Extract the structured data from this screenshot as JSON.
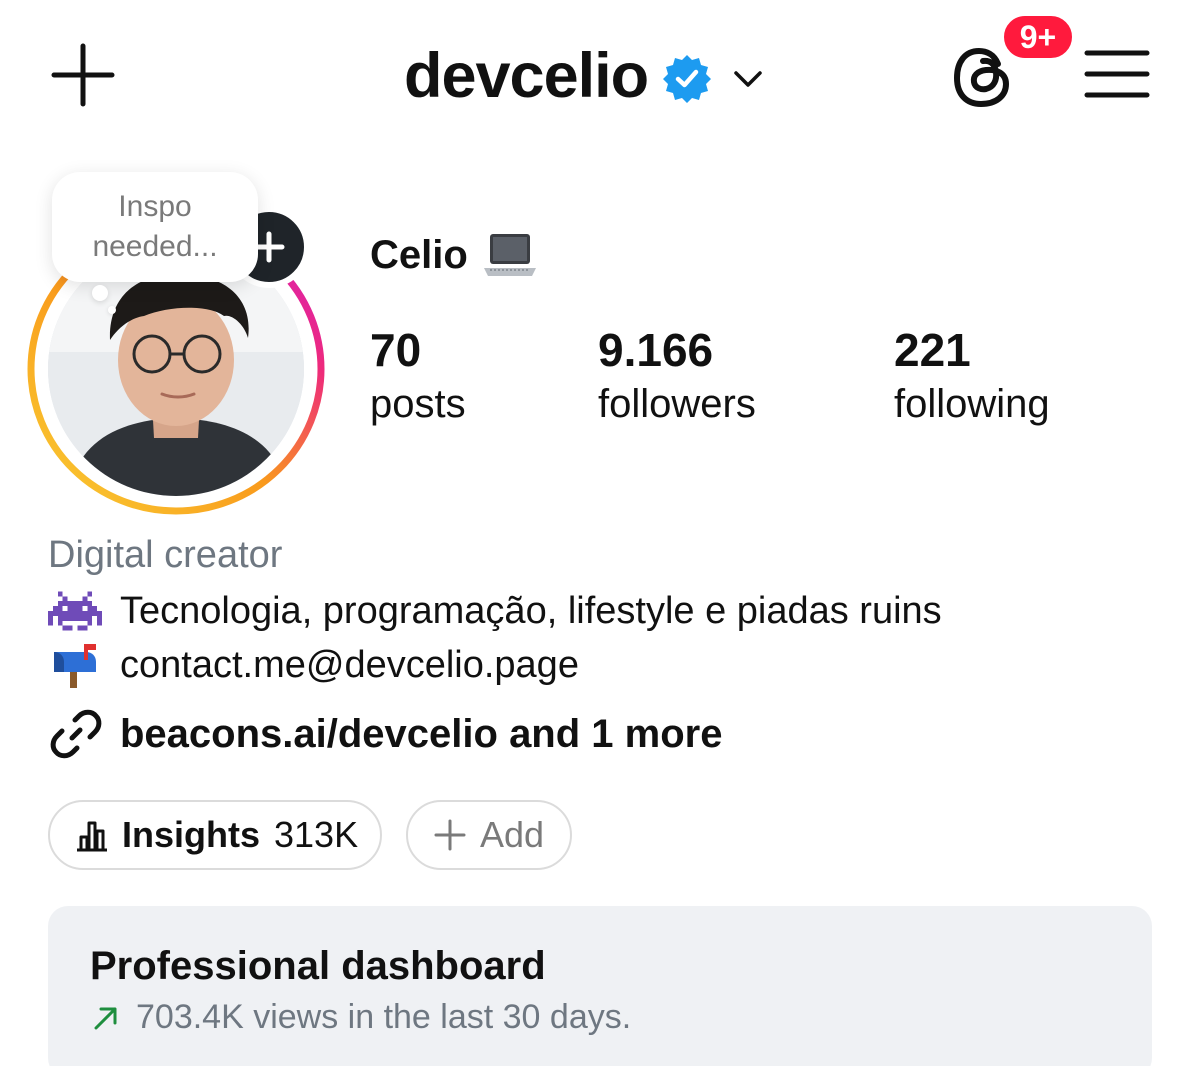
{
  "header": {
    "username": "devcelio",
    "notification_badge": "9+",
    "icons": {
      "create": "plus-icon",
      "verified": "verified-badge-icon",
      "switcher": "chevron-down-icon",
      "threads": "threads-icon",
      "menu": "hamburger-menu-icon"
    }
  },
  "profile": {
    "note": "Inspo needed...",
    "display_name": "Celio",
    "display_name_emoji": "laptop-icon",
    "stats": [
      {
        "value": "70",
        "label": "posts"
      },
      {
        "value": "9.166",
        "label": "followers"
      },
      {
        "value": "221",
        "label": "following"
      }
    ]
  },
  "bio": {
    "category": "Digital creator",
    "lines": [
      {
        "icon": "alien-monster-icon",
        "text": "Tecnologia, programação, lifestyle e piadas ruins"
      },
      {
        "icon": "mailbox-icon",
        "text": "contact.me@devcelio.page"
      }
    ],
    "link": "beacons.ai/devcelio and 1 more"
  },
  "actions": {
    "insights_label": "Insights",
    "insights_value": "313K",
    "add_label": "Add"
  },
  "dashboard": {
    "title": "Professional dashboard",
    "subtitle": "703.4K views in the last 30 days."
  },
  "colors": {
    "verified": "#1d9bf0",
    "badge": "#ff1a3d",
    "trend": "#1e8e3e",
    "ring_start": "#f9ce34",
    "ring_mid": "#ee2a7b",
    "ring_end": "#d21dc8",
    "dashboard_bg": "#eff1f4"
  }
}
